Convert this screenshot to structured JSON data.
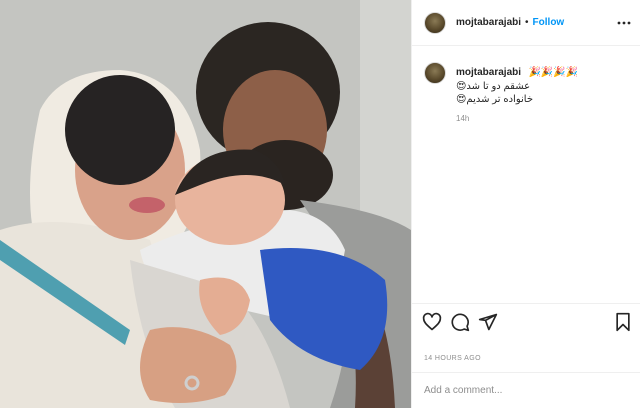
{
  "post": {
    "username": "mojtabarajabi",
    "separator": "•",
    "follow_label": "Follow",
    "caption_emojis": "🎉🎉🎉🎉",
    "caption_lines": [
      "عشقم دو تا شد😍",
      "خانواده تر شدیم😍"
    ],
    "time_short": "14h",
    "time_full": "14 HOURS AGO",
    "comment_placeholder": "Add a comment..."
  },
  "icons": {
    "more": "more-options-icon",
    "like": "heart-icon",
    "comment": "comment-icon",
    "share": "share-icon",
    "save": "bookmark-icon"
  },
  "colors": {
    "follow": "#0095f6",
    "muted_text": "#8e8e8e",
    "divider": "#efefef"
  }
}
